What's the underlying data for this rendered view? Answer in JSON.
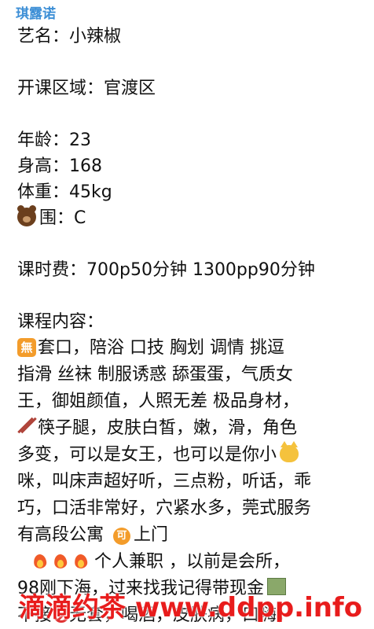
{
  "message": {
    "sender": "琪露诺",
    "stage_name": "艺名：小辣椒",
    "area": "开课区域：官渡区",
    "age": "年龄：23",
    "height": "身高：168",
    "weight": "体重：45kg",
    "bust": "围：C",
    "fee": "课时费：700p50分钟  1300pp90分钟",
    "content_heading": "课程内容：",
    "lines": [
      "套口，陪浴 口技 胸划   调情 挑逗",
      "指滑  丝袜 制服诱惑 舔蛋蛋，气质女",
      "王，御姐颜值，人照无差  极品身材，",
      "筷子腿，皮肤白皙，嫩，滑，角色",
      "多变，可以是女王，也可以是你小",
      "咪，叫床声超好听，三点粉，听话，乖",
      "巧，口活非常好，穴紧水多，莞式服务",
      "有高段公寓",
      "上门",
      "个人兼职 ，以前是会所，",
      "98刚下海，过来找我记得带现金",
      "不接",
      "无套，喝酒，皮肤病，口嗨，"
    ],
    "badge_wu": "無",
    "badge_ke": "可"
  },
  "watermark": "滴滴约茶 www.ddpp.info",
  "colors": {
    "sender": "#3d8fd6",
    "badge": "#f39c2b",
    "watermark": "#e81c1c"
  },
  "icons": [
    "bear-icon",
    "no-badge-icon",
    "chopsticks-icon",
    "cat-icon",
    "ok-badge-icon",
    "fire-icon",
    "money-icon",
    "no-entry-icon"
  ]
}
